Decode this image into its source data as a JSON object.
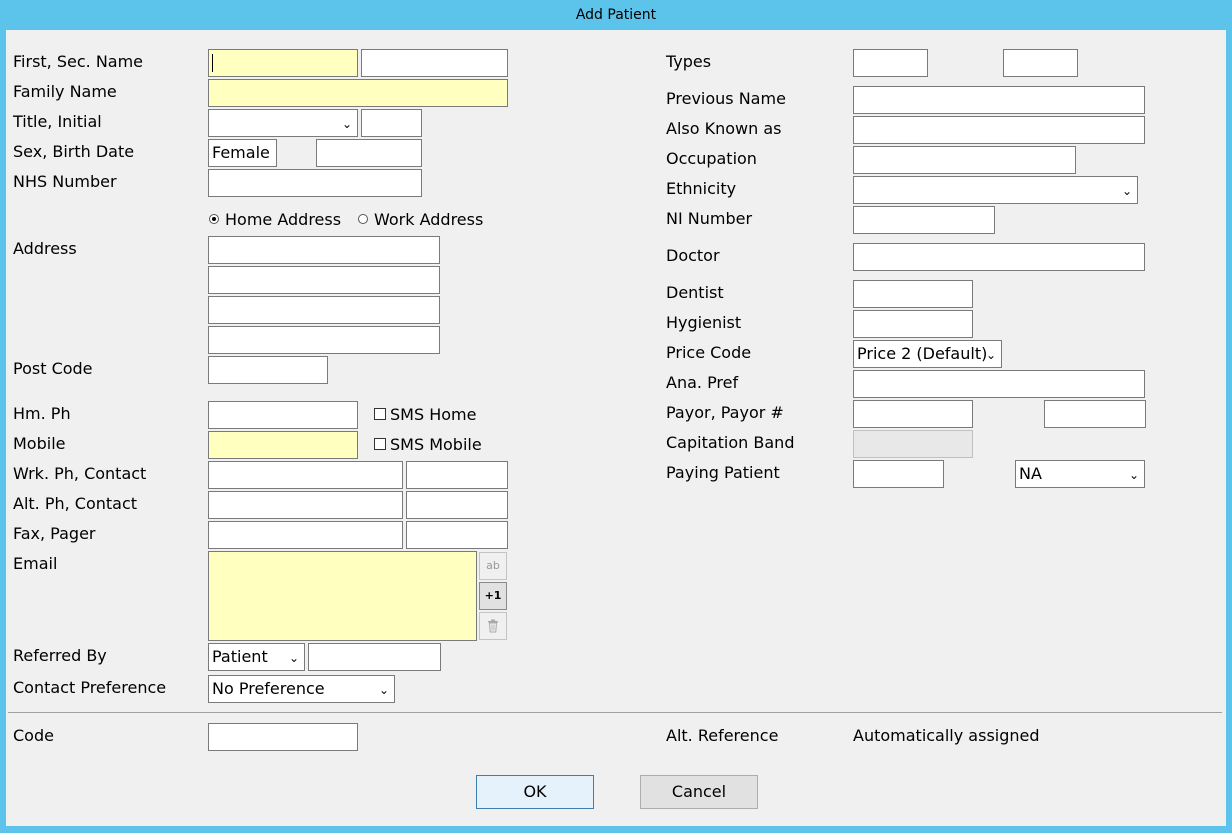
{
  "window": {
    "title": "Add Patient"
  },
  "left": {
    "first_sec_name_label": "First, Sec. Name",
    "family_name_label": "Family Name",
    "title_initial_label": "Title, Initial",
    "sex_birth_label": "Sex, Birth Date",
    "sex_value": "Female",
    "nhs_label": "NHS Number",
    "home_address_label": "Home Address",
    "work_address_label": "Work Address",
    "address_label": "Address",
    "post_code_label": "Post Code",
    "hm_ph_label": "Hm. Ph",
    "sms_home_label": "SMS Home",
    "mobile_label": "Mobile",
    "sms_mobile_label": "SMS Mobile",
    "wrk_ph_label": "Wrk. Ph, Contact",
    "alt_ph_label": "Alt. Ph, Contact",
    "fax_label": "Fax, Pager",
    "email_label": "Email",
    "email_add_icon": "ab",
    "email_plus_one": "+1",
    "referred_by_label": "Referred By",
    "referred_by_value": "Patient",
    "contact_pref_label": "Contact Preference",
    "contact_pref_value": "No Preference",
    "code_label": "Code"
  },
  "right": {
    "types_label": "Types",
    "previous_name_label": "Previous Name",
    "aka_label": "Also Known as",
    "occupation_label": "Occupation",
    "ethnicity_label": "Ethnicity",
    "ni_label": "NI Number",
    "doctor_label": "Doctor",
    "dentist_label": "Dentist",
    "hygienist_label": "Hygienist",
    "price_code_label": "Price Code",
    "price_code_value": "Price 2 (Default)",
    "ana_pref_label": "Ana. Pref",
    "payor_label": "Payor, Payor #",
    "capitation_label": "Capitation Band",
    "paying_patient_label": "Paying Patient",
    "paying_patient_value": "NA",
    "alt_ref_label": "Alt. Reference",
    "alt_ref_value": "Automatically assigned"
  },
  "buttons": {
    "ok": "OK",
    "cancel": "Cancel"
  },
  "icons": {
    "chevron": "chevron-down-icon",
    "trash": "trash-icon"
  },
  "colors": {
    "frame": "#5cc4ea",
    "highlight_field": "#ffffc0"
  }
}
